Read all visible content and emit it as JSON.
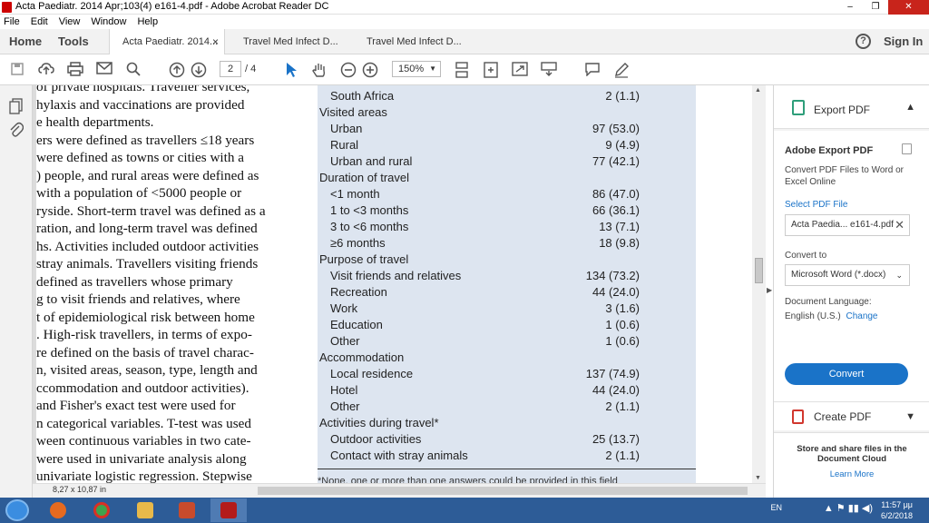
{
  "window": {
    "title": "Acta Paediatr. 2014 Apr;103(4) e161-4.pdf - Adobe Acrobat Reader DC",
    "controls": {
      "minimize": "–",
      "restore": "❐",
      "close": "✕"
    }
  },
  "menu": [
    "File",
    "Edit",
    "View",
    "Window",
    "Help"
  ],
  "nav": {
    "home": "Home",
    "tools": "Tools",
    "sign_in": "Sign In"
  },
  "tabs": [
    {
      "label": "Acta Paediatr. 2014...",
      "close": "×"
    },
    {
      "label": "Travel Med Infect D..."
    },
    {
      "label": "Travel Med Infect D..."
    }
  ],
  "toolbar": {
    "page_current": "2",
    "page_total": "/ 4",
    "zoom": "150%"
  },
  "document": {
    "body_lines": [
      "of private hospitals. Traveller services,",
      "hylaxis and vaccinations are provided",
      "e health departments.",
      "ers were defined as travellers ≤18 years",
      "were defined as towns or cities with a",
      ") people, and rural areas were defined as",
      "with a population of <5000 people or",
      "ryside. Short-term travel was defined as a",
      "ration, and long-term travel was defined",
      "hs. Activities included outdoor activities",
      "stray animals. Travellers visiting friends",
      "defined as travellers whose primary",
      "g to visit friends and relatives, where",
      "t of epidemiological risk between home",
      ". High-risk travellers, in terms of expo-",
      "re defined on the basis of travel charac-",
      "n, visited areas, season, type, length and",
      "ccommodation and outdoor activities).",
      "and Fisher's exact test were used for",
      "n categorical variables. T-test was used",
      "ween continuous variables in two cate-",
      "were used in univariate analysis along",
      "univariate logistic regression. Stepwise"
    ],
    "table_rows": [
      {
        "label": "South Africa",
        "value": "2 (1.1)",
        "indent": true
      },
      {
        "label": "Visited areas",
        "value": "",
        "indent": false
      },
      {
        "label": "Urban",
        "value": "97 (53.0)",
        "indent": true
      },
      {
        "label": "Rural",
        "value": "9 (4.9)",
        "indent": true
      },
      {
        "label": "Urban and rural",
        "value": "77 (42.1)",
        "indent": true
      },
      {
        "label": "Duration of travel",
        "value": "",
        "indent": false
      },
      {
        "label": "<1 month",
        "value": "86 (47.0)",
        "indent": true
      },
      {
        "label": "1 to <3 months",
        "value": "66 (36.1)",
        "indent": true
      },
      {
        "label": "3 to <6 months",
        "value": "13 (7.1)",
        "indent": true
      },
      {
        "label": "≥6 months",
        "value": "18 (9.8)",
        "indent": true
      },
      {
        "label": "Purpose of travel",
        "value": "",
        "indent": false
      },
      {
        "label": "Visit friends and relatives",
        "value": "134 (73.2)",
        "indent": true
      },
      {
        "label": "Recreation",
        "value": "44 (24.0)",
        "indent": true
      },
      {
        "label": "Work",
        "value": "3 (1.6)",
        "indent": true
      },
      {
        "label": "Education",
        "value": "1 (0.6)",
        "indent": true
      },
      {
        "label": "Other",
        "value": "1 (0.6)",
        "indent": true
      },
      {
        "label": "Accommodation",
        "value": "",
        "indent": false
      },
      {
        "label": "Local residence",
        "value": "137 (74.9)",
        "indent": true
      },
      {
        "label": "Hotel",
        "value": "44 (24.0)",
        "indent": true
      },
      {
        "label": "Other",
        "value": "2 (1.1)",
        "indent": true
      },
      {
        "label": "Activities during travel*",
        "value": "",
        "indent": false
      },
      {
        "label": "Outdoor activities",
        "value": "25 (13.7)",
        "indent": true
      },
      {
        "label": "Contact with stray animals",
        "value": "2 (1.1)",
        "indent": true
      }
    ],
    "footnote": "*None, one or more than one answers could be provided in this field",
    "page_size": "8,27 x 10,87 in"
  },
  "right_panel": {
    "export_title": "Export PDF",
    "aep_title": "Adobe Export PDF",
    "aep_desc": "Convert PDF Files to Word or Excel Online",
    "select_pdf": "Select PDF File",
    "file_name": "Acta Paedia... e161-4.pdf",
    "convert_to": "Convert to",
    "format": "Microsoft Word (*.docx)",
    "doc_lang_label": "Document Language:",
    "doc_lang_value": "English (U.S.)",
    "change": "Change",
    "convert_btn": "Convert",
    "create_pdf": "Create PDF",
    "store_text": "Store and share files in the Document Cloud",
    "learn_more": "Learn More"
  },
  "taskbar": {
    "lang": "EN",
    "time": "11:57 μμ",
    "date": "6/2/2018"
  },
  "colors": {
    "accent": "#1a73c8",
    "taskbar": "#2d5c97",
    "table_bg": "#dde5f0",
    "close": "#c8241b"
  }
}
